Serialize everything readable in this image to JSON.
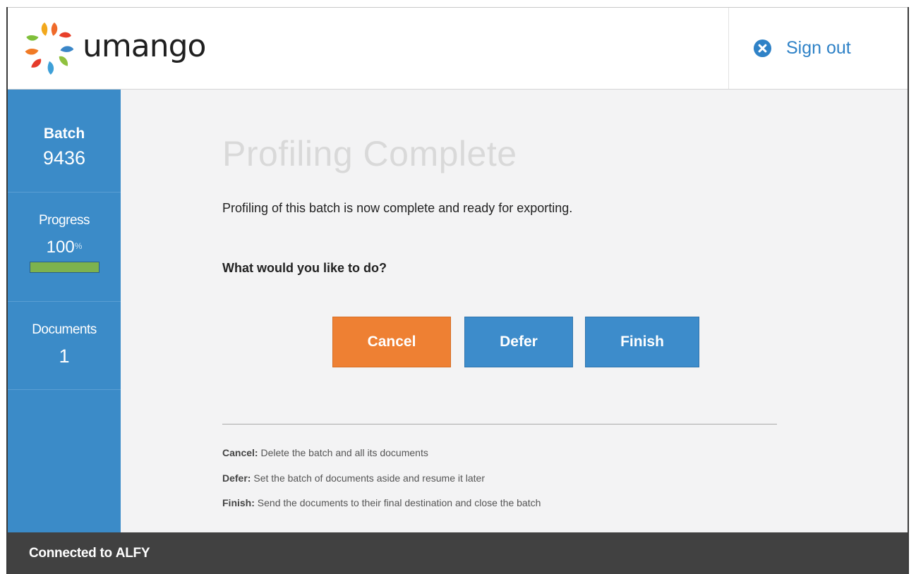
{
  "header": {
    "logo_text": "umango",
    "signout_label": "Sign out",
    "icons": {
      "logo": "umango-flower-logo-icon",
      "signout": "close-circle-icon"
    }
  },
  "sidebar": {
    "batch": {
      "label": "Batch",
      "value": "9436"
    },
    "progress": {
      "label": "Progress",
      "value": "100",
      "unit": "%",
      "fraction": 1.0
    },
    "documents": {
      "label": "Documents",
      "value": "1"
    }
  },
  "main": {
    "title": "Profiling Complete",
    "intro": "Profiling of this batch is now complete and ready for exporting.",
    "question": "What would you like to do?",
    "buttons": {
      "cancel": "Cancel",
      "defer": "Defer",
      "finish": "Finish"
    },
    "help": [
      {
        "term": "Cancel:",
        "text": " Delete the batch and all its documents"
      },
      {
        "term": "Defer:",
        "text": " Set the batch of documents aside and resume it later"
      },
      {
        "term": "Finish:",
        "text": " Send the documents to their final destination and close the batch"
      }
    ]
  },
  "footer": {
    "prefix": "Connected to",
    "server": "ALFY"
  },
  "colors": {
    "sidebar": "#3b8bc8",
    "cancel": "#ee8033",
    "primary": "#3d8ccb",
    "progress_fill": "#7db24e",
    "footer": "#414141",
    "link": "#2f82c7"
  }
}
